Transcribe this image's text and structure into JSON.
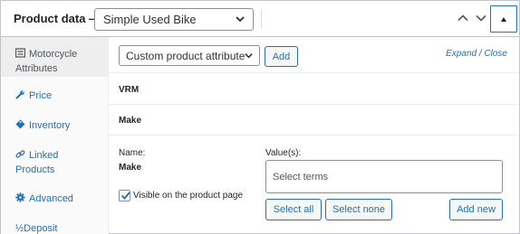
{
  "header": {
    "title": "Product data —",
    "product_type": "Simple Used Bike"
  },
  "sidebar": {
    "items": [
      {
        "label": "Motorcycle Attributes",
        "icon": "list-icon",
        "active": true
      },
      {
        "label": "Price",
        "icon": "wrench-icon"
      },
      {
        "label": "Inventory",
        "icon": "tag-icon"
      },
      {
        "label": "Linked Products",
        "icon": "link-icon"
      },
      {
        "label": "Advanced",
        "icon": "gear-icon"
      },
      {
        "label": "½Deposit",
        "icon": ""
      }
    ]
  },
  "toolbar": {
    "attribute_select": "Custom product attribute",
    "add_label": "Add",
    "expand_label": "Expand",
    "slash": "/",
    "close_label": "Close"
  },
  "attributes": [
    {
      "name": "VRM"
    },
    {
      "name": "Make"
    }
  ],
  "attribute_detail": {
    "name_label": "Name:",
    "name_value": "Make",
    "values_label": "Value(s):",
    "terms_placeholder": "Select terms",
    "visible_label": "Visible on the product page",
    "visible_checked": true,
    "select_all_label": "Select all",
    "select_none_label": "Select none",
    "add_new_label": "Add new"
  },
  "colors": {
    "link": "#2271b1",
    "border": "#c3c4c7"
  }
}
